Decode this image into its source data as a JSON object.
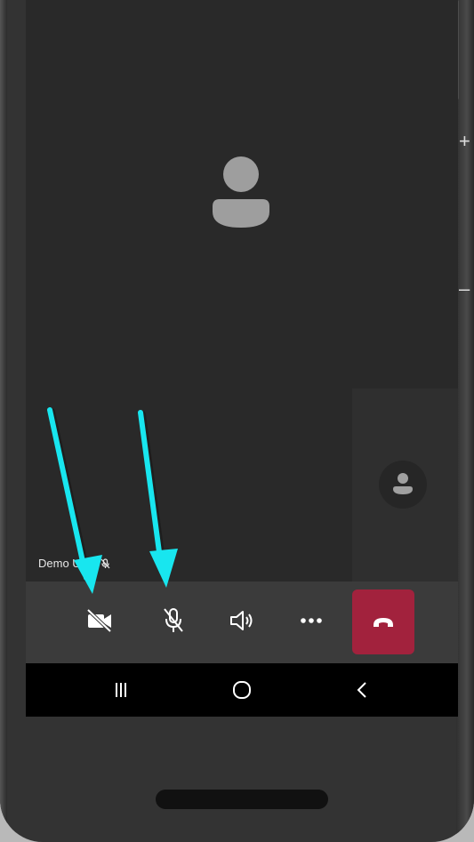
{
  "participant": {
    "name": "Demo User",
    "muted_icon": "mic-off-icon"
  },
  "toolbar": {
    "buttons": [
      {
        "icon": "video-off-icon"
      },
      {
        "icon": "mic-off-icon"
      },
      {
        "icon": "speaker-icon"
      },
      {
        "icon": "more-icon"
      },
      {
        "icon": "end-call-icon"
      }
    ],
    "end_call_color": "#a2223d"
  },
  "android_nav": {
    "buttons": [
      {
        "icon": "recent-apps-icon"
      },
      {
        "icon": "home-icon"
      },
      {
        "icon": "back-icon"
      }
    ]
  },
  "side_controls": {
    "plus": "+",
    "minus": "–"
  },
  "annotation": {
    "arrow_color": "#18e6ef",
    "targets": [
      "video-toggle-button",
      "mic-toggle-button"
    ]
  }
}
